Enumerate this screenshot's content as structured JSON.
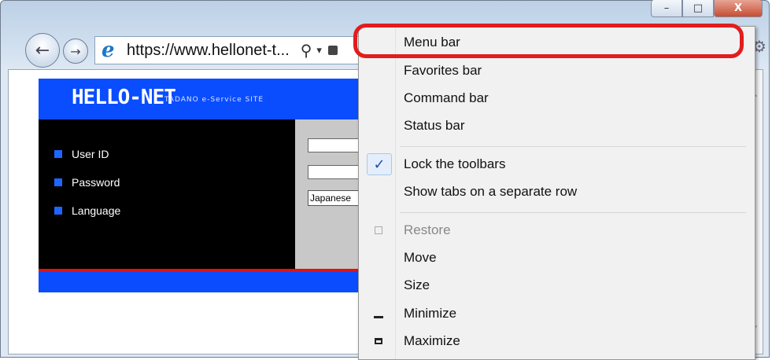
{
  "browser": {
    "url": "https://www.hellonet-t...",
    "caption_buttons": {
      "minimize": "–",
      "maximize": "□",
      "close": "X"
    }
  },
  "site": {
    "logo": "HELLO-NET",
    "tagline": "TADANO e-Service SITE",
    "fields": [
      {
        "label": "User ID"
      },
      {
        "label": "Password"
      },
      {
        "label": "Language"
      }
    ],
    "language_value": "Japanese",
    "colors": {
      "header": "#0a4dff",
      "panel": "#000000",
      "accent_line": "#e51010"
    }
  },
  "context_menu": {
    "items": [
      {
        "label": "Menu bar",
        "checked": false,
        "disabled": false
      },
      {
        "label": "Favorites bar",
        "checked": false,
        "disabled": false
      },
      {
        "label": "Command bar",
        "checked": false,
        "disabled": false
      },
      {
        "label": "Status bar",
        "checked": false,
        "disabled": false
      },
      {
        "label": "Lock the toolbars",
        "checked": true,
        "disabled": false
      },
      {
        "label": "Show tabs on a separate row",
        "checked": false,
        "disabled": false
      },
      {
        "label": "Restore",
        "checked": false,
        "disabled": true,
        "icon": "restore-icon"
      },
      {
        "label": "Move",
        "checked": false,
        "disabled": false
      },
      {
        "label": "Size",
        "checked": false,
        "disabled": false
      },
      {
        "label": "Minimize",
        "checked": false,
        "disabled": false,
        "icon": "minimize-icon"
      },
      {
        "label": "Maximize",
        "checked": false,
        "disabled": false,
        "icon": "maximize-icon"
      }
    ],
    "highlighted_item": "Menu bar",
    "highlight_color": "#e31c1c"
  }
}
